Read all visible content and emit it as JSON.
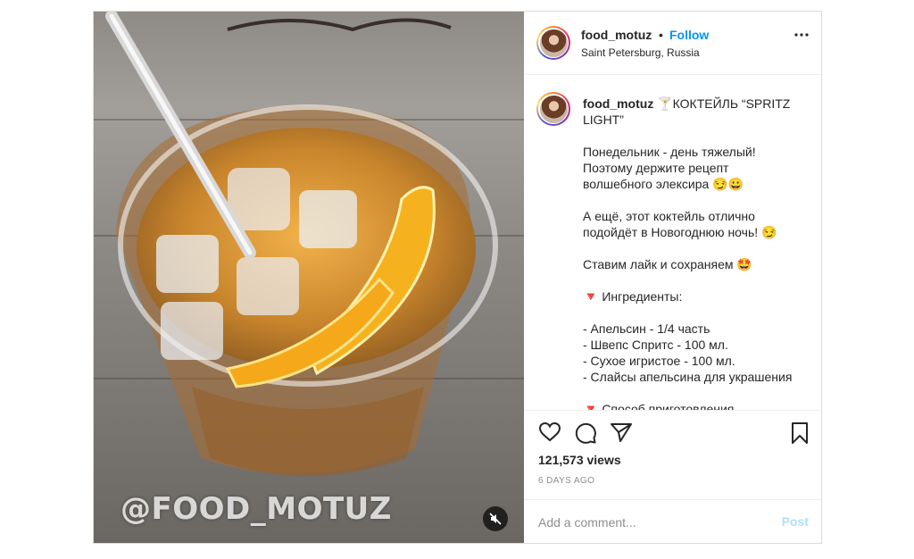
{
  "header": {
    "username": "food_motuz",
    "separator": "•",
    "follow_label": "Follow",
    "location": "Saint Petersburg, Russia",
    "more_icon": "more-horizontal-icon"
  },
  "media": {
    "watermark": "@FOOD_MOTUZ",
    "mute_icon": "muted-speaker-icon"
  },
  "caption": {
    "username": "food_motuz",
    "title_line1": " 🍸КОКТЕЙЛЬ “SPRITZ",
    "title_line2": "LIGHT”",
    "p1": [
      "Понедельник - день тяжелый!",
      "Поэтому держите рецепт",
      "волшебного элексира 😏😀"
    ],
    "p2": [
      "А ещё, этот коктейль отлично",
      "подойдёт в Новогоднюю ночь! 😏"
    ],
    "p3": "Ставим лайк и сохраняем 🤩",
    "ingredients_title": "🔻 Ингредиенты:",
    "ingredients": [
      "- Апельсин - 1/4 часть",
      "- Швепс Спритс - 100 мл.",
      "- Сухое игристое - 100 мл.",
      "- Слайсы апельсина для украшения"
    ],
    "method_title": "🔻 Способ приготовления"
  },
  "actions": {
    "like_icon": "heart-icon",
    "comment_icon": "comment-icon",
    "share_icon": "paper-plane-icon",
    "save_icon": "bookmark-icon"
  },
  "stats": {
    "views": "121,573 views",
    "time": "6 DAYS AGO"
  },
  "comment": {
    "placeholder": "Add a comment...",
    "post_label": "Post"
  },
  "colors": {
    "link_blue": "#0095f6",
    "post_disabled": "#b2dffc",
    "muted_text": "#8e8e8e"
  }
}
